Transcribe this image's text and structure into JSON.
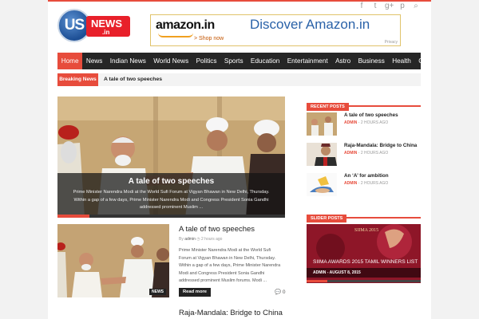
{
  "header": {
    "logo_us": "US",
    "logo_news": "NEWS",
    "logo_tld": ".in",
    "social": [
      {
        "icon": "facebook-icon",
        "glyph": "f"
      },
      {
        "icon": "twitter-icon",
        "glyph": "t"
      },
      {
        "icon": "google-plus-icon",
        "glyph": "g+"
      },
      {
        "icon": "pinterest-icon",
        "glyph": "p"
      },
      {
        "icon": "search-icon",
        "glyph": "⌕"
      }
    ]
  },
  "ad": {
    "brand": "amazon.in",
    "shop_link": "> Shop now",
    "headline": "Discover Amazon.in",
    "privacy": "Privacy"
  },
  "nav": {
    "items": [
      "Home",
      "News",
      "Indian News",
      "World News",
      "Politics",
      "Sports",
      "Education",
      "Entertainment",
      "Astro",
      "Business",
      "Health",
      "Guest Post"
    ]
  },
  "breaking": {
    "label": "Breaking News",
    "headline": "A tale of two speeches"
  },
  "feature": {
    "title": "A tale of two speeches",
    "excerpt": "Prime Minister Narendra Modi at the World Sufi Forum at Vigyan Bhawan in New Delhi, Thursday. Within a gap of a few days, Prime Minister Narendra Modi and Congress President Sonia Gandhi addressed prominent Muslim ..."
  },
  "article": {
    "category": "NEWS",
    "title": "A tale of two speeches",
    "author_prefix": "By",
    "author": "admin",
    "time": "2 hours ago",
    "excerpt": "Prime Minister Narendra Modi at the World Sufi Forum at Vigyan Bhawan in New Delhi, Thursday. Within a gap of a few days, Prime Minister Narendra Modi and Congress President Sonia Gandhi addressed prominent Muslim forums. Modi ...",
    "read_more": "Read more",
    "comments": "0",
    "next_title": "Raja-Mandala: Bridge to China"
  },
  "sidebar": {
    "recent_heading": "RECENT POSTS",
    "recent": [
      {
        "title": "A tale of two speeches",
        "author": "ADMIN",
        "time": "2 HOURS AGO"
      },
      {
        "title": "Raja-Mandala: Bridge to China",
        "author": "ADMIN",
        "time": "2 HOURS AGO"
      },
      {
        "title": "An ‘A’ for ambition",
        "author": "ADMIN",
        "time": "2 HOURS AGO"
      }
    ],
    "slider_heading": "SLIDER POSTS",
    "slider": {
      "logo": "SIIMA 2015",
      "title": "SIIMA AWARDS 2015 TAMIL WINNERS LIST",
      "caption": "ADMIN - AUGUST 8, 2015"
    }
  },
  "colors": {
    "accent": "#e74c3c",
    "nav": "#262626"
  }
}
